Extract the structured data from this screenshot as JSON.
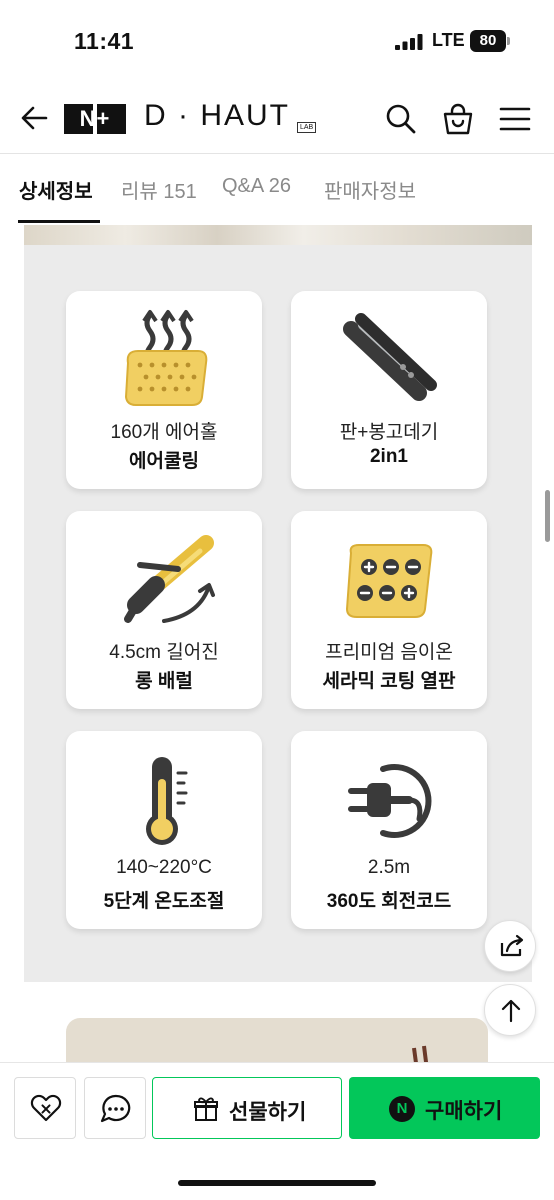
{
  "status_bar": {
    "time": "11:41",
    "network": "LTE",
    "battery": "80"
  },
  "header": {
    "logo_badge": "N+",
    "brand": "D · HAUT",
    "brand_sub": "LAB"
  },
  "tabs": [
    {
      "label": "상세정보",
      "active": true
    },
    {
      "label": "리뷰 151",
      "active": false
    },
    {
      "label": "Q&A 26",
      "active": false
    },
    {
      "label": "판매자정보",
      "active": false
    }
  ],
  "features": [
    {
      "icon": "air-holes-icon",
      "line1": "160개 에어홀",
      "line2": "에어쿨링"
    },
    {
      "icon": "flat-iron-icon",
      "line1": "판+봉고데기",
      "line2": "2in1"
    },
    {
      "icon": "curling-iron-icon",
      "line1": "4.5cm 길어진",
      "line2": "롱 배럴"
    },
    {
      "icon": "ion-plate-icon",
      "line1": "프리미엄 음이온",
      "line2": "세라믹 코팅 열판"
    },
    {
      "icon": "thermometer-icon",
      "line1": "140~220°C",
      "line2": "5단계 온도조절"
    },
    {
      "icon": "swivel-cord-icon",
      "line1": "2.5m",
      "line2": "360도 회전코드"
    }
  ],
  "bottom_bar": {
    "gift_label": "선물하기",
    "buy_label": "구매하기",
    "buy_badge": "N"
  },
  "colors": {
    "accent_green": "#03c75a",
    "panel_bg": "#ebebeb",
    "icon_gold": "#f1cf62",
    "icon_dark": "#3a3a3a"
  }
}
